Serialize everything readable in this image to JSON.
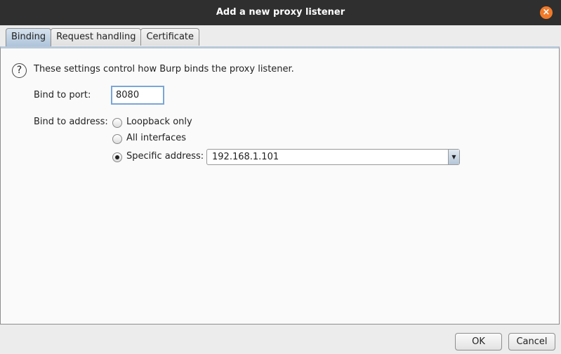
{
  "dialog": {
    "title": "Add a new proxy listener",
    "close_icon": "close-icon"
  },
  "tabs": [
    {
      "label": "Binding",
      "active": true
    },
    {
      "label": "Request handling"
    },
    {
      "label": "Certificate"
    }
  ],
  "binding": {
    "help_text": "These settings control how Burp binds the proxy listener.",
    "port_label": "Bind to port:",
    "port_value": "8080",
    "address_label": "Bind to address:",
    "options": [
      {
        "label": "Loopback only",
        "selected": false
      },
      {
        "label": "All interfaces",
        "selected": false
      },
      {
        "label": "Specific address:",
        "selected": true
      }
    ],
    "address_value": "192.168.1.101"
  },
  "buttons": {
    "ok": "OK",
    "cancel": "Cancel"
  }
}
